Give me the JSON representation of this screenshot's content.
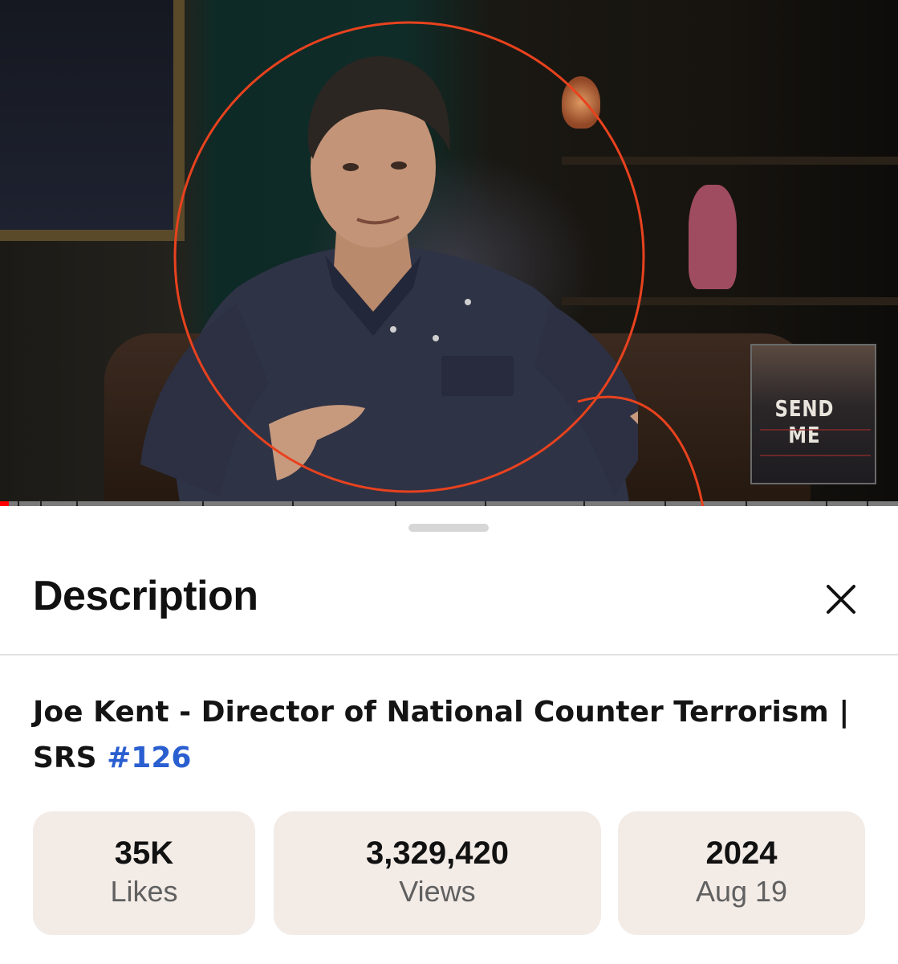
{
  "video": {
    "book_title": "SEND ME",
    "progress": 0.01,
    "chapter_marks": [
      0.02,
      0.045,
      0.085,
      0.225,
      0.325,
      0.44,
      0.54,
      0.65,
      0.74,
      0.83,
      0.92,
      0.965
    ]
  },
  "sheet": {
    "title": "Description",
    "close_icon": "close-icon"
  },
  "video_info": {
    "title_main": "Joe Kent - Director of National Counter Terrorism | SRS ",
    "hashtag": "#126"
  },
  "stats": {
    "likes_value": "35K",
    "likes_label": "Likes",
    "views_value": "3,329,420",
    "views_label": "Views",
    "year_value": "2024",
    "date_label": "Aug 19"
  },
  "colors": {
    "annotation": "#e8421e",
    "hashtag": "#2a5fd0",
    "stat_bg": "#f3ebe6",
    "progress": "#ff0000"
  }
}
